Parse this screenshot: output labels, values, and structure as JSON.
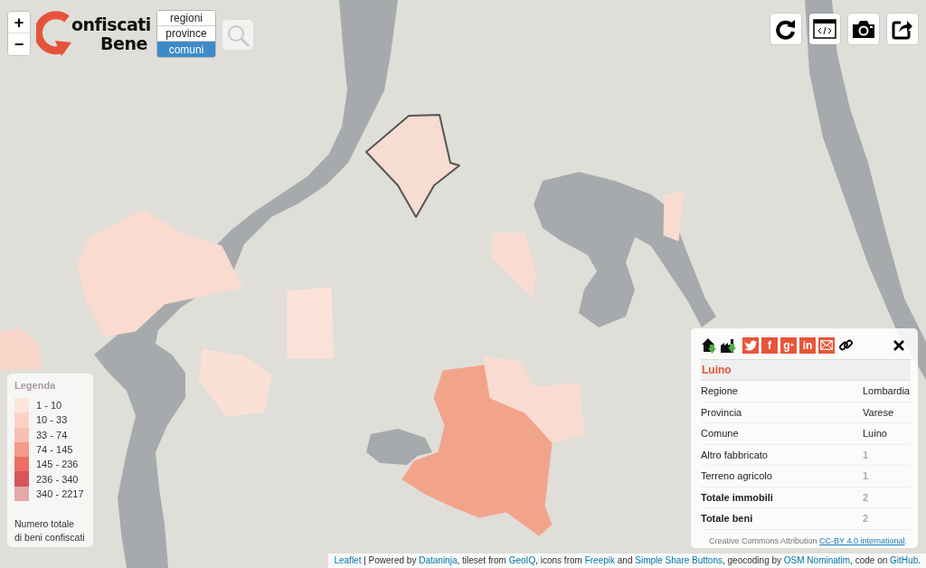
{
  "zoom_control": {
    "zoom_in": "+",
    "zoom_out": "−"
  },
  "logo": {
    "line_1": "onfiscati",
    "line_2": "Bene"
  },
  "level_selector": [
    {
      "label": "regioni",
      "selected": false
    },
    {
      "label": "province",
      "selected": false
    },
    {
      "label": "comuni",
      "selected": true
    }
  ],
  "toolbar": [
    {
      "kind": "refresh"
    },
    {
      "kind": "embed"
    },
    {
      "kind": "camera"
    },
    {
      "kind": "share"
    }
  ],
  "map": {
    "areas": [
      {
        "color": "#f6dcd1",
        "selected": true
      },
      {
        "color": "#f9dccf",
        "selected": false
      },
      {
        "color": "#f8d5c8",
        "selected": false
      },
      {
        "color": "#fae2d8",
        "selected": false
      },
      {
        "color": "#fae0d5",
        "selected": false
      },
      {
        "color": "#f2a48b",
        "selected": false
      },
      {
        "color": "#f9dcd1",
        "selected": false
      },
      {
        "color": "#f9dcd0",
        "selected": false
      },
      {
        "color": "#f9dcd0",
        "selected": false
      }
    ]
  },
  "legend": {
    "title": "Legenda",
    "classes": [
      {
        "label": "1 - 10",
        "color": "#fbe5dd"
      },
      {
        "label": "10 - 33",
        "color": "#fbd3c5"
      },
      {
        "label": "33 - 74",
        "color": "#f8c0b0"
      },
      {
        "label": "74 - 145",
        "color": "#f49a88"
      },
      {
        "label": "145 - 236",
        "color": "#ee6f62"
      },
      {
        "label": "236 - 340",
        "color": "#d9545a"
      },
      {
        "label": "340 - 2217",
        "color": "#e3a9a9"
      }
    ],
    "caption": "Numero totale\ndi beni confiscati"
  },
  "info_panel": {
    "downloads": [
      {
        "kind": "house"
      },
      {
        "kind": "factory"
      }
    ],
    "share_buttons": [
      {
        "kind": "twitter"
      },
      {
        "kind": "letters",
        "label": "f"
      },
      {
        "kind": "letters",
        "label": "g$^{+}$"
      },
      {
        "kind": "letters",
        "label": "in"
      },
      {
        "kind": "email"
      }
    ],
    "title": "Luino",
    "rows": [
      {
        "kind": "place",
        "label": "Regione",
        "value": "Lombardia"
      },
      {
        "kind": "place",
        "label": "Provincia",
        "value": "Varese"
      },
      {
        "kind": "place",
        "label": "Comune",
        "value": "Luino"
      },
      {
        "kind": "count",
        "label": "Altro fabbricato",
        "value": "1"
      },
      {
        "kind": "count",
        "label": "Terreno agricolo",
        "value": "1"
      },
      {
        "kind": "total",
        "label": "Totale immobili",
        "value": "2"
      },
      {
        "kind": "total",
        "label": "Totale beni",
        "value": "2"
      }
    ],
    "license": [
      {
        "kind": "text",
        "text": "Creative Commons Attribution "
      },
      {
        "kind": "link",
        "text": "CC-BY 4.0 international"
      },
      {
        "kind": "text",
        "text": "."
      }
    ]
  },
  "attribution": [
    {
      "kind": "link",
      "text": "Leaflet"
    },
    {
      "kind": "text",
      "text": " | Powered by "
    },
    {
      "kind": "link",
      "text": "Dataninja"
    },
    {
      "kind": "text",
      "text": ", tileset from "
    },
    {
      "kind": "link",
      "text": "GeoIQ"
    },
    {
      "kind": "text",
      "text": ", icons from "
    },
    {
      "kind": "link",
      "text": "Freepik"
    },
    {
      "kind": "text",
      "text": " and "
    },
    {
      "kind": "link",
      "text": "Simple Share Buttons"
    },
    {
      "kind": "text",
      "text": ", geocoding by "
    },
    {
      "kind": "link",
      "text": "OSM Nominatim"
    },
    {
      "kind": "text",
      "text": ", code on "
    },
    {
      "kind": "link",
      "text": "GitHub"
    },
    {
      "kind": "text",
      "text": "."
    }
  ]
}
